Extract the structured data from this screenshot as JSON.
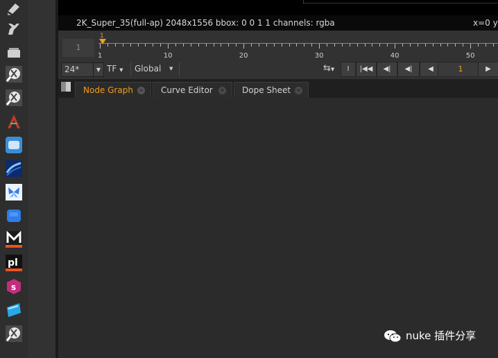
{
  "viewer": {
    "format_info": "2K_Super_35(full-ap) 2048x1556  bbox: 0 0 1 1 channels: rgba",
    "coords": "x=0 y"
  },
  "timeline": {
    "frame_box": "1",
    "playhead_label": "1",
    "ruler_labels": [
      "1",
      "10",
      "20",
      "30",
      "40",
      "50"
    ]
  },
  "controls": {
    "fps": "24*",
    "tf": "TF",
    "range": "Global",
    "current_frame": "1"
  },
  "tabs": [
    {
      "label": "Node Graph"
    },
    {
      "label": "Curve Editor"
    },
    {
      "label": "Dope Sheet"
    }
  ],
  "watermark": {
    "text": "nuke 插件分享"
  },
  "colors": {
    "accent": "#f39c1f",
    "panel": "#2b2b2b",
    "toolbar": "#2e2e2e"
  },
  "toolbar_icons": [
    "paint-icon",
    "wrench-icon",
    "stack-icon",
    "globe-plugin-icon",
    "globe-plugin-icon",
    "red-a-icon",
    "cloud-app-icon",
    "blue-swirl-icon",
    "butterfly-icon",
    "blue-cube-icon",
    "m-logo-icon",
    "pl-logo-icon",
    "pink-s-icon",
    "blue-card-icon",
    "globe-plugin-icon"
  ]
}
